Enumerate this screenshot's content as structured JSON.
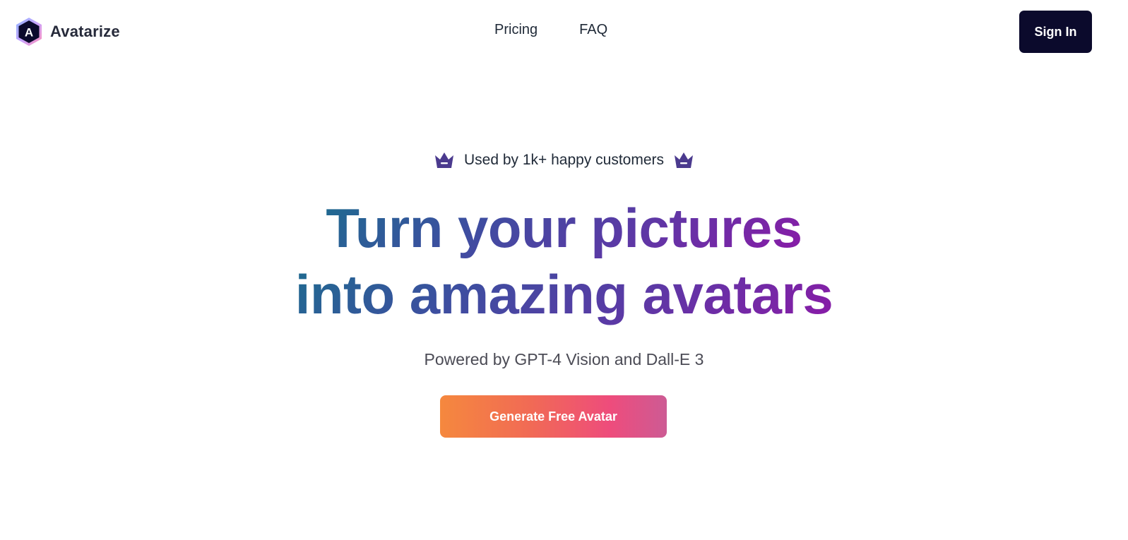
{
  "brand": {
    "name": "Avatarize",
    "logo_letter": "A",
    "logo_icon": "hexagon-logo-icon"
  },
  "nav": {
    "items": [
      {
        "label": "Pricing"
      },
      {
        "label": "FAQ"
      }
    ]
  },
  "header": {
    "sign_in_label": "Sign In"
  },
  "hero": {
    "badge_text": "Used by 1k+ happy customers",
    "badge_icon": "crown-icon",
    "headline_line1": "Turn your pictures",
    "headline_line2": "into amazing avatars",
    "subtitle": "Powered by GPT-4 Vision and Dall-E 3",
    "cta_label": "Generate Free Avatar"
  },
  "colors": {
    "sign_in_bg": "#0b0a2c",
    "crown": "#4b3a8e",
    "headline_gradient_start": "#1e6b8f",
    "headline_gradient_end": "#8a1aa7",
    "cta_gradient_start": "#f5883e",
    "cta_gradient_end": "#cd5b94"
  }
}
